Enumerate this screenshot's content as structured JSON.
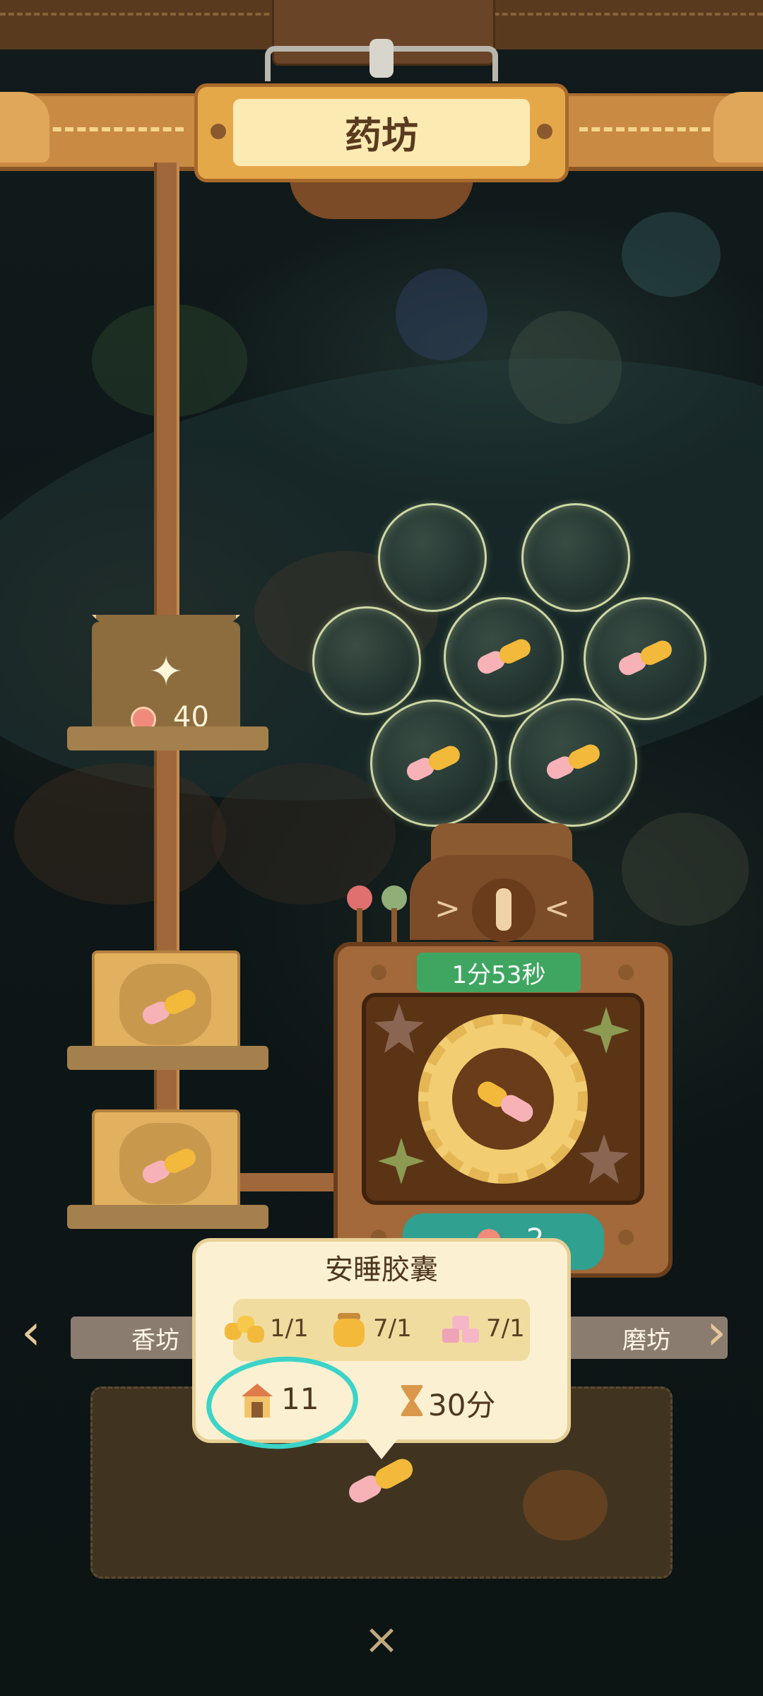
{
  "header": {
    "title": "药坊"
  },
  "left_shelf": {
    "cost": "40",
    "icon": "sparkle-icon",
    "cost_icon": "flower-coin-icon"
  },
  "queue": {
    "slots": [
      {
        "item": "capsule-icon"
      },
      {
        "item": "capsule-icon"
      }
    ]
  },
  "bubbles": [
    {
      "filled": false
    },
    {
      "filled": false
    },
    {
      "filled": false
    },
    {
      "filled": true,
      "item": "capsule-icon"
    },
    {
      "filled": true,
      "item": "capsule-icon"
    },
    {
      "filled": true,
      "item": "capsule-icon"
    },
    {
      "filled": true,
      "item": "capsule-icon"
    }
  ],
  "machine": {
    "timer": "1分53秒",
    "speedup_cost": "2"
  },
  "popup": {
    "title": "安睡胶囊",
    "ingredients": [
      {
        "icon": "honeycomb-icon",
        "amount": "1/1"
      },
      {
        "icon": "honey-jar-icon",
        "amount": "7/1"
      },
      {
        "icon": "sugar-cubes-icon",
        "amount": "7/1"
      }
    ],
    "level": "11",
    "duration": "30分"
  },
  "nav": {
    "prev_label": "香坊",
    "next_label": "磨坊"
  },
  "close_label": "×",
  "colors": {
    "timer_green": "#3fa661",
    "annotation_cyan": "#3cd3c8",
    "wood": "#a3693a"
  }
}
